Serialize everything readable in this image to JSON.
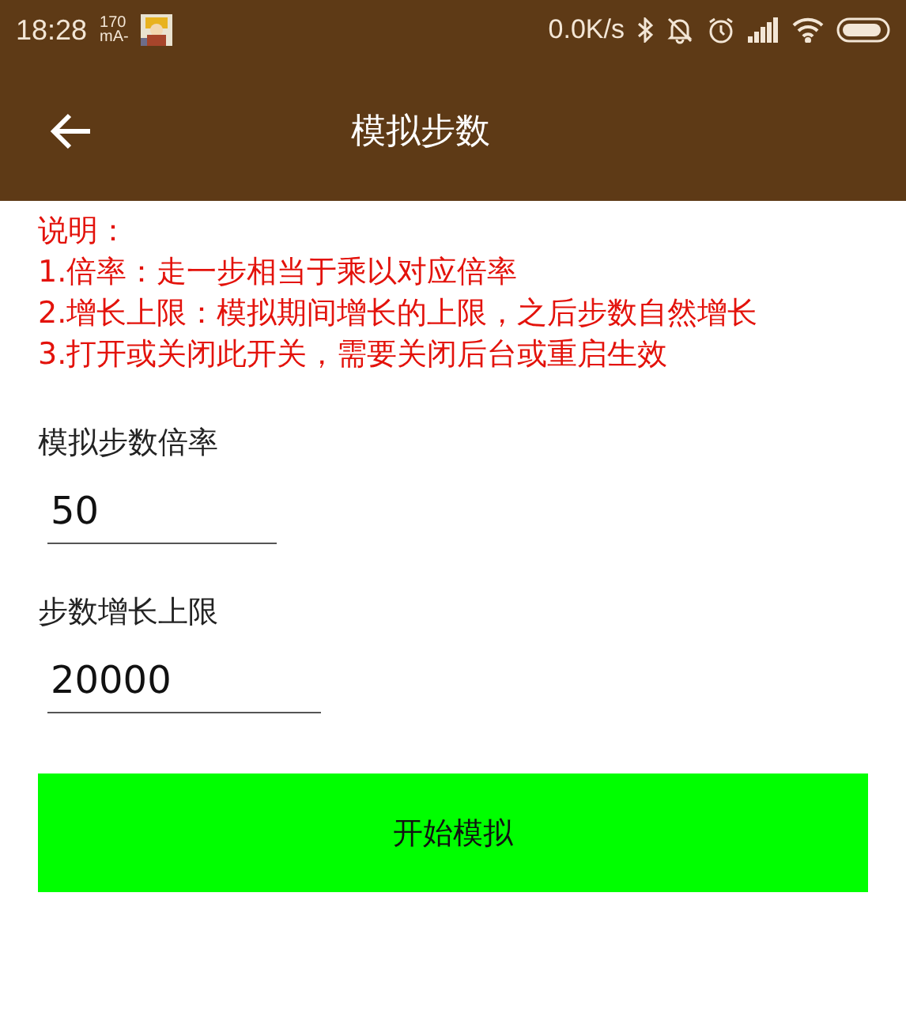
{
  "status_bar": {
    "time": "18:28",
    "current_value": "170",
    "current_unit": "mA-",
    "speed": "0.0K/s"
  },
  "toolbar": {
    "title": "模拟步数"
  },
  "notes": [
    "说明：",
    "1.倍率：走一步相当于乘以对应倍率",
    "2.增长上限：模拟期间增长的上限，之后步数自然增长",
    "3.打开或关闭此开关，需要关闭后台或重启生效"
  ],
  "fields": [
    {
      "label": "模拟步数倍率",
      "value": "50"
    },
    {
      "label": "步数增长上限",
      "value": "20000"
    }
  ],
  "button": {
    "label": "开始模拟"
  }
}
